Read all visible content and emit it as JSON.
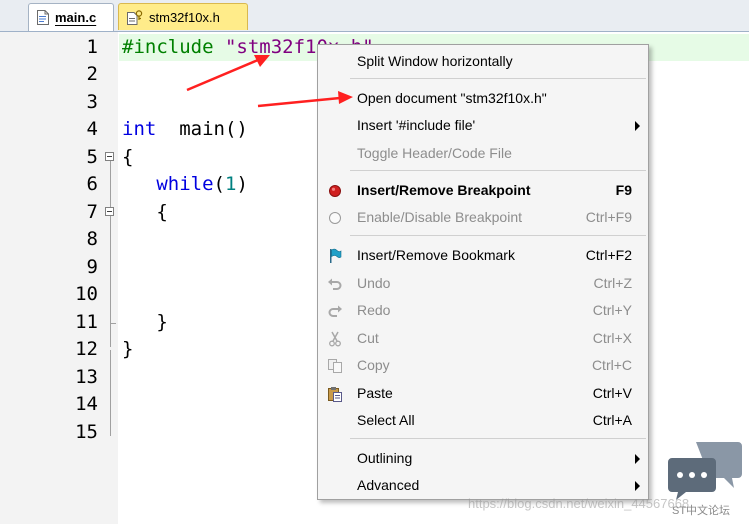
{
  "tabs": [
    {
      "label": "main.c",
      "icon": "c-file-icon",
      "active": true
    },
    {
      "label": "stm32f10x.h",
      "icon": "header-file-icon",
      "active": false
    }
  ],
  "editor": {
    "line_numbers": [
      "1",
      "2",
      "3",
      "4",
      "5",
      "6",
      "7",
      "8",
      "9",
      "10",
      "11",
      "12",
      "13",
      "14",
      "15"
    ],
    "code": {
      "l1_directive": "#include",
      "l1_string": "\"stm32f10x.h\"",
      "l4_type": "int",
      "l4_rest": "  main()",
      "l5": "{",
      "l6_kw": "while",
      "l6_open": "(",
      "l6_num": "1",
      "l6_close": ")",
      "l7": "{",
      "l11": "}",
      "l12": "}"
    },
    "colors": {
      "keyword": "#0000e0",
      "preprocessor": "#008000",
      "string": "#800080",
      "number": "#008080",
      "current_line": "#e6fbe6"
    }
  },
  "context_menu": {
    "items": [
      {
        "label": "Split Window horizontally",
        "shortcut": "",
        "enabled": true
      },
      {
        "label": "Open document \"stm32f10x.h\"",
        "shortcut": "",
        "enabled": true
      },
      {
        "label": "Insert '#include file'",
        "shortcut": "",
        "enabled": true,
        "submenu": true
      },
      {
        "label": "Toggle Header/Code File",
        "shortcut": "",
        "enabled": false
      },
      {
        "label": "Insert/Remove Breakpoint",
        "shortcut": "F9",
        "enabled": true,
        "icon": "breakpoint-icon"
      },
      {
        "label": "Enable/Disable Breakpoint",
        "shortcut": "Ctrl+F9",
        "enabled": false,
        "icon": "breakpoint-disabled-icon"
      },
      {
        "label": "Insert/Remove Bookmark",
        "shortcut": "Ctrl+F2",
        "enabled": true,
        "icon": "bookmark-flag-icon"
      },
      {
        "label": "Undo",
        "shortcut": "Ctrl+Z",
        "enabled": false,
        "icon": "undo-icon"
      },
      {
        "label": "Redo",
        "shortcut": "Ctrl+Y",
        "enabled": false,
        "icon": "redo-icon"
      },
      {
        "label": "Cut",
        "shortcut": "Ctrl+X",
        "enabled": false,
        "icon": "cut-icon"
      },
      {
        "label": "Copy",
        "shortcut": "Ctrl+C",
        "enabled": false,
        "icon": "copy-icon"
      },
      {
        "label": "Paste",
        "shortcut": "Ctrl+V",
        "enabled": true,
        "icon": "paste-icon"
      },
      {
        "label": "Select All",
        "shortcut": "Ctrl+A",
        "enabled": true
      },
      {
        "label": "Outlining",
        "shortcut": "",
        "enabled": true,
        "submenu": true
      },
      {
        "label": "Advanced",
        "shortcut": "",
        "enabled": true,
        "submenu": true
      }
    ]
  },
  "annotations": {
    "arrow_color": "#ff2020"
  },
  "watermark": {
    "url_text": "https://blog.csdn.net/weixin_44567668",
    "logo_text": "ST中文论坛"
  }
}
